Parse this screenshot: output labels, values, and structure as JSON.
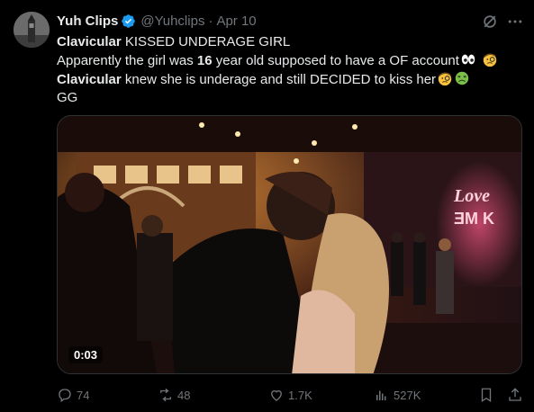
{
  "post": {
    "author_name": "Yuh Clips",
    "handle": "@Yuhclips",
    "separator": "·",
    "date": "Apr 10",
    "lines": {
      "l1_bold": "Clavicular",
      "l1_rest": " KISSED UNDERAGE GIRL",
      "l2_a": "Apparently the girl was ",
      "l2_bold": "16",
      "l2_b": " year old supposed to have a OF account",
      "l3_bold": "Clavicular",
      "l3_rest": " knew she is underage and still DECIDED to kiss her",
      "l4": "GG"
    },
    "emojis": [
      "eyes",
      "face-with-monocle",
      "face-with-monocle",
      "nauseated-face"
    ]
  },
  "media": {
    "type": "video",
    "timestamp": "0:03",
    "sign_text_top": "Love",
    "sign_text_bottom": "ƎM K"
  },
  "actions": {
    "replies": "74",
    "reposts": "48",
    "likes": "1.7K",
    "views": "527K"
  },
  "colors": {
    "background": "#000000",
    "text": "#e7e9ea",
    "muted": "#71767b",
    "verified": "#1d9bf0"
  }
}
